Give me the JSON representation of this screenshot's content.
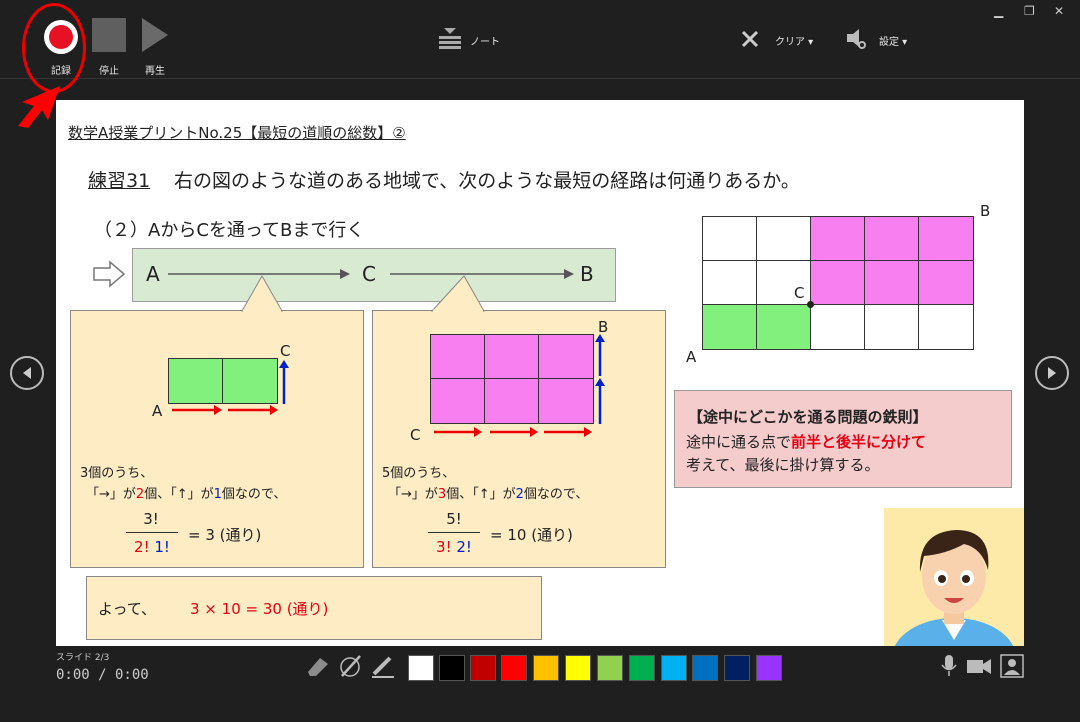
{
  "toolbar": {
    "record_label": "記録",
    "stop_label": "停止",
    "play_label": "再生",
    "notes_label": "ノート",
    "clear_label": "クリア ▾",
    "settings_label": "設定 ▾"
  },
  "slide": {
    "title": "数学A授業プリントNo.25【最短の道順の総数】②",
    "exercise_label": "練習31",
    "exercise_text": "右の図のような道のある地域で、次のような最短の経路は何通りあるか。",
    "subproblem": "（２）AからCを通ってBまで行く",
    "route": {
      "a": "A",
      "c": "C",
      "b": "B"
    },
    "left_box": {
      "label_a": "A",
      "label_c": "C",
      "line1": "3個のうち、",
      "line2_parts": [
        "「→」が",
        "2",
        "個、「↑」が",
        "1",
        "個なので、"
      ],
      "numerator": "3!",
      "denominator_red": "2!",
      "denominator_blue": "1!",
      "result": "= 3 (通り)"
    },
    "right_box": {
      "label_c": "C",
      "label_b": "B",
      "line1": "5個のうち、",
      "line2_parts": [
        "「→」が",
        "3",
        "個、「↑」が",
        "2",
        "個なので、"
      ],
      "numerator": "5!",
      "denominator_red": "3!",
      "denominator_blue": "2!",
      "result": "= 10 (通り)"
    },
    "answer_prefix": "よって、",
    "answer": "3 × 10 = 30 (通り)",
    "grid_labels": {
      "a": "A",
      "b": "B",
      "c": "C"
    },
    "rule_box": {
      "title": "【途中にどこかを通る問題の鉄則】",
      "line1_prefix": "途中に通る点で",
      "line1_emph": "前半と後半に分けて",
      "line2": "考えて、最後に掛け算する。"
    }
  },
  "status": {
    "slide_counter": "スライド 2/3",
    "time": "0:00 / 0:00"
  },
  "colors": {
    "swatches": [
      "#ffffff",
      "#000000",
      "#c00000",
      "#ff0000",
      "#ffc000",
      "#ffff00",
      "#92d050",
      "#00b050",
      "#00b0f0",
      "#0070c0",
      "#002060",
      "#9933ff"
    ],
    "accent_red": "#e60012"
  },
  "icons": [
    "record-icon",
    "stop-icon",
    "play-icon",
    "notes-icon",
    "clear-icon",
    "settings-icon",
    "eraser-icon",
    "pen-icon",
    "highlighter-icon",
    "microphone-icon",
    "camera-icon",
    "presenter-view-icon",
    "prev-slide-icon",
    "next-slide-icon"
  ]
}
